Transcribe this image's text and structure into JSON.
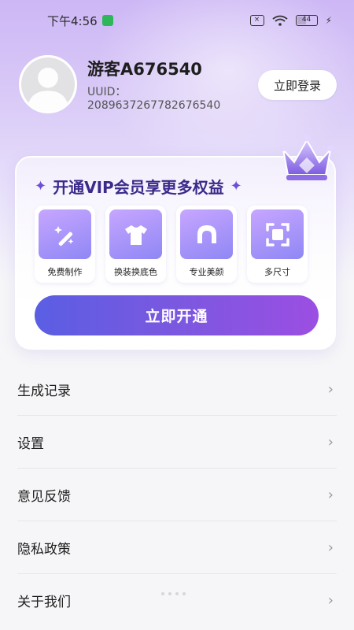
{
  "status_bar": {
    "time": "下午4:56",
    "battery": "44"
  },
  "profile": {
    "username": "游客A676540",
    "uuid_label": "UUID：",
    "uuid_value": "2089637267782676540",
    "login_label": "立即登录"
  },
  "vip": {
    "title": "开通VIP会员享更多权益",
    "features": [
      {
        "label": "免费制作",
        "icon": "magic-wand-icon"
      },
      {
        "label": "换装换底色",
        "icon": "tshirt-icon"
      },
      {
        "label": "专业美颜",
        "icon": "face-outline-icon"
      },
      {
        "label": "多尺寸",
        "icon": "crop-frame-icon"
      }
    ],
    "button_label": "立即开通"
  },
  "menu": {
    "items": [
      {
        "label": "生成记录"
      },
      {
        "label": "设置"
      },
      {
        "label": "意见反馈"
      },
      {
        "label": "隐私政策"
      },
      {
        "label": "关于我们"
      }
    ]
  },
  "colors": {
    "accent_start": "#5a5ee3",
    "accent_end": "#9b4ee2",
    "title_purple": "#3b2a8a"
  }
}
